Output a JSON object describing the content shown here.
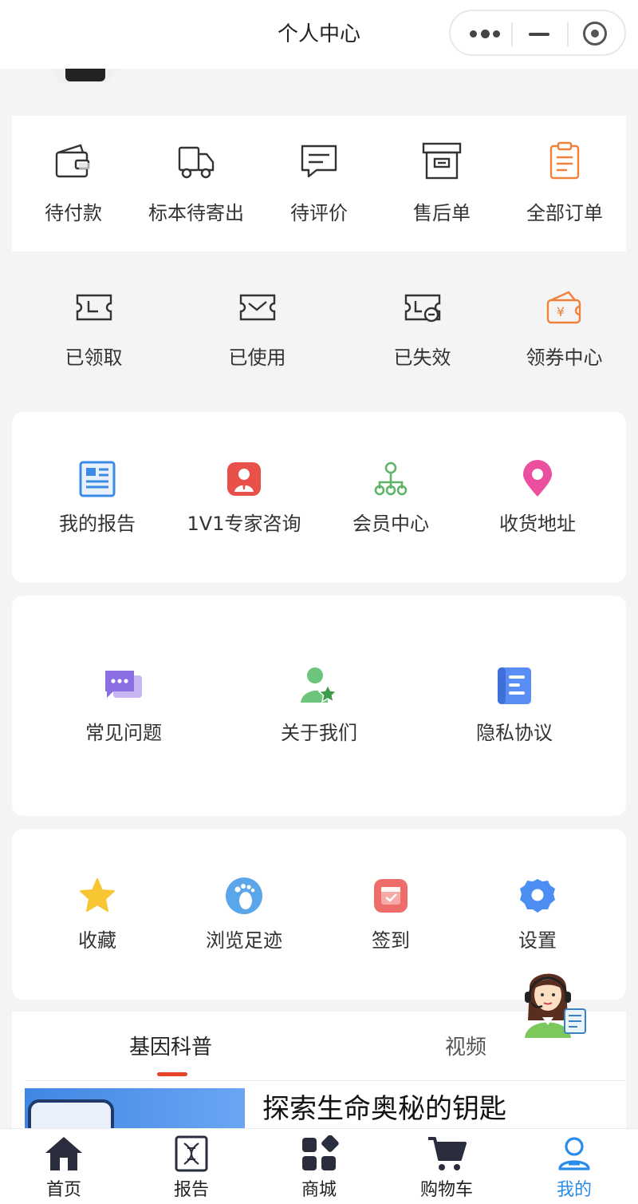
{
  "nav": {
    "title": "个人中心"
  },
  "orders": [
    {
      "label": "待付款",
      "icon": "wallet-icon"
    },
    {
      "label": "标本待寄出",
      "icon": "truck-icon"
    },
    {
      "label": "待评价",
      "icon": "comment-icon"
    },
    {
      "label": "售后单",
      "icon": "archive-box-icon"
    },
    {
      "label": "全部订单",
      "icon": "clipboard-icon"
    }
  ],
  "coupons": [
    {
      "label": "已领取",
      "icon": "coupon-clock-icon"
    },
    {
      "label": "已使用",
      "icon": "coupon-check-icon"
    },
    {
      "label": "已失效",
      "icon": "coupon-expired-icon"
    },
    {
      "label": "领券中心",
      "icon": "coupon-wallet-icon"
    }
  ],
  "services": [
    {
      "label": "我的报告",
      "icon": "report-doc-icon"
    },
    {
      "label": "1V1专家咨询",
      "icon": "expert-icon"
    },
    {
      "label": "会员中心",
      "icon": "member-tree-icon"
    },
    {
      "label": "收货地址",
      "icon": "location-pin-icon"
    }
  ],
  "help": [
    {
      "label": "常见问题",
      "icon": "faq-chat-icon"
    },
    {
      "label": "关于我们",
      "icon": "about-user-star-icon"
    },
    {
      "label": "隐私协议",
      "icon": "privacy-doc-icon"
    }
  ],
  "tools": [
    {
      "label": "收藏",
      "icon": "star-icon"
    },
    {
      "label": "浏览足迹",
      "icon": "footprint-icon"
    },
    {
      "label": "签到",
      "icon": "calendar-check-icon"
    },
    {
      "label": "设置",
      "icon": "gear-icon"
    }
  ],
  "content_tabs": [
    {
      "label": "基因科普",
      "active": true
    },
    {
      "label": "视频",
      "active": false
    }
  ],
  "article": {
    "title": "探索生命奥秘的钥匙"
  },
  "tabbar": [
    {
      "label": "首页",
      "icon": "home-icon",
      "active": false
    },
    {
      "label": "报告",
      "icon": "dna-report-icon",
      "active": false
    },
    {
      "label": "商城",
      "icon": "mall-grid-icon",
      "active": false
    },
    {
      "label": "购物车",
      "icon": "cart-icon",
      "active": false
    },
    {
      "label": "我的",
      "icon": "profile-icon",
      "active": true
    }
  ],
  "colors": {
    "accent": "#2b8be8",
    "tab_underline": "#e8442a",
    "orange": "#f0813a"
  }
}
